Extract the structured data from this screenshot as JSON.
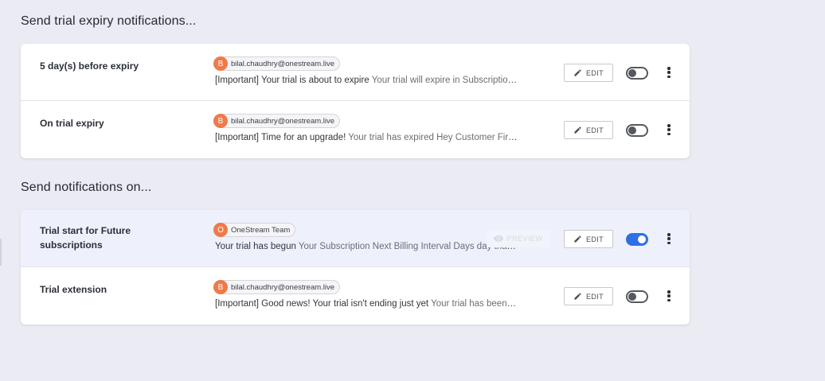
{
  "sections": [
    {
      "title": "Send trial expiry notifications...",
      "rows": [
        {
          "label": "5 day(s) before expiry",
          "sender_initial": "B",
          "sender": "bilal.chaudhry@onestream.live",
          "subject": "[Important] Your trial is about to expire",
          "body": " Your trial will expire in Subscription Next Billing Interval Days days",
          "edit_label": "EDIT",
          "enabled": false
        },
        {
          "label": "On trial expiry",
          "sender_initial": "B",
          "sender": "bilal.chaudhry@onestream.live",
          "subject": "[Important] Time for an upgrade!",
          "body": " Your trial has expired Hey Customer First Name, your trial has ended",
          "edit_label": "EDIT",
          "enabled": false
        }
      ]
    },
    {
      "title": "Send notifications on...",
      "rows": [
        {
          "label": "Trial start for Future subscriptions",
          "sender_initial": "O",
          "sender": "OneStream Team",
          "subject": "Your trial has begun",
          "body": " Your Subscription Next Billing Interval Days day trial has started",
          "preview_label": "PREVIEW",
          "edit_label": "EDIT",
          "enabled": true
        },
        {
          "label": "Trial extension",
          "sender_initial": "B",
          "sender": "bilal.chaudhry@onestream.live",
          "subject": "[Important] Good news! Your trial isn't ending just yet",
          "body": " Your trial has been extended",
          "edit_label": "EDIT",
          "enabled": false
        }
      ]
    }
  ],
  "colors": {
    "page_bg": "#ebebf3",
    "avatar": "#f07a4a",
    "toggle_on": "#2f6fe6",
    "hover_row": "#eef1fb"
  },
  "icons": {
    "edit": "pencil-icon",
    "preview": "eye-icon",
    "more": "kebab-menu-icon"
  }
}
